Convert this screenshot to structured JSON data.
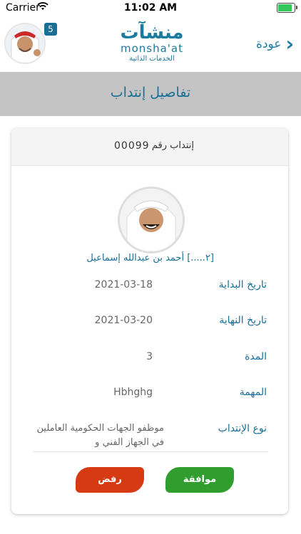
{
  "status_bar": {
    "carrier": "Carrier",
    "time": "11:02 AM"
  },
  "header": {
    "back_label": "عودة",
    "logo_arabic": "منشآت",
    "logo_english": "monsha'at",
    "logo_subtitle": "الخدمات الذاتية",
    "notification_count": "5"
  },
  "title": "تفاصيل إنتداب",
  "card": {
    "number_label": "إنتداب رقم",
    "number_value": "00099",
    "employee_name": "[۲.....] أحمد بن عبدالله إسماعيل",
    "rows": [
      {
        "label": "تاريخ البداية",
        "value": "2021-03-18"
      },
      {
        "label": "تاريخ النهاية",
        "value": "2021-03-20"
      },
      {
        "label": "المدة",
        "value": "3"
      },
      {
        "label": "المهمة",
        "value": "Hbhghg"
      },
      {
        "label": "نوع الإنتداب",
        "value": "موظفو الجهات الحكومية العاملين في الجهاز الفني و"
      }
    ]
  },
  "actions": {
    "approve": "موافقة",
    "reject": "رفض"
  },
  "colors": {
    "primary": "#1a6f96",
    "approve": "#2f9e2f",
    "reject": "#d63a12"
  }
}
